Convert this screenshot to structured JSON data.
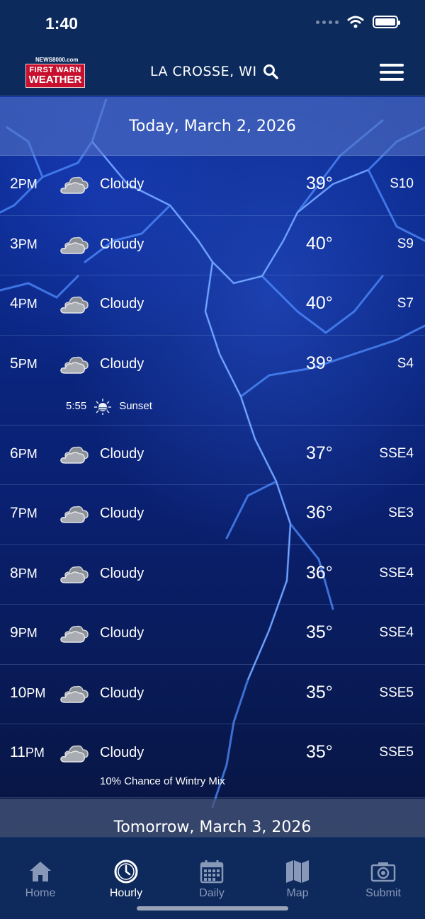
{
  "status": {
    "time": "1:40"
  },
  "header": {
    "logo_top": "NEWS8000.com",
    "logo_line1": "FIRST WARN",
    "logo_line2": "WEATHER",
    "location": "LA CROSSE, WI"
  },
  "today_label": "Today, March 2, 2026",
  "hours": [
    {
      "hour": "2",
      "ampm": "PM",
      "condition": "Cloudy",
      "temp": "39°",
      "wind": "S10"
    },
    {
      "hour": "3",
      "ampm": "PM",
      "condition": "Cloudy",
      "temp": "40°",
      "wind": "S9"
    },
    {
      "hour": "4",
      "ampm": "PM",
      "condition": "Cloudy",
      "temp": "40°",
      "wind": "S7"
    },
    {
      "hour": "5",
      "ampm": "PM",
      "condition": "Cloudy",
      "temp": "39°",
      "wind": "S4"
    },
    {
      "hour": "6",
      "ampm": "PM",
      "condition": "Cloudy",
      "temp": "37°",
      "wind": "SSE4"
    },
    {
      "hour": "7",
      "ampm": "PM",
      "condition": "Cloudy",
      "temp": "36°",
      "wind": "SE3"
    },
    {
      "hour": "8",
      "ampm": "PM",
      "condition": "Cloudy",
      "temp": "36°",
      "wind": "SSE4"
    },
    {
      "hour": "9",
      "ampm": "PM",
      "condition": "Cloudy",
      "temp": "35°",
      "wind": "SSE4"
    },
    {
      "hour": "10",
      "ampm": "PM",
      "condition": "Cloudy",
      "temp": "35°",
      "wind": "SSE5"
    },
    {
      "hour": "11",
      "ampm": "PM",
      "condition": "Cloudy",
      "temp": "35°",
      "wind": "SSE5"
    }
  ],
  "sunset": {
    "time": "5:55",
    "label": "Sunset"
  },
  "chance_note": "10% Chance of Wintry Mix",
  "tomorrow_label": "Tomorrow, March 3, 2026",
  "tabs": [
    {
      "label": "Home",
      "icon": "home-icon"
    },
    {
      "label": "Hourly",
      "icon": "clock-icon"
    },
    {
      "label": "Daily",
      "icon": "calendar-icon"
    },
    {
      "label": "Map",
      "icon": "map-icon"
    },
    {
      "label": "Submit",
      "icon": "camera-icon"
    }
  ],
  "colors": {
    "header_bg": "#0c2b5c",
    "logo_red": "#c8102e",
    "tab_inactive": "#8898b8"
  }
}
